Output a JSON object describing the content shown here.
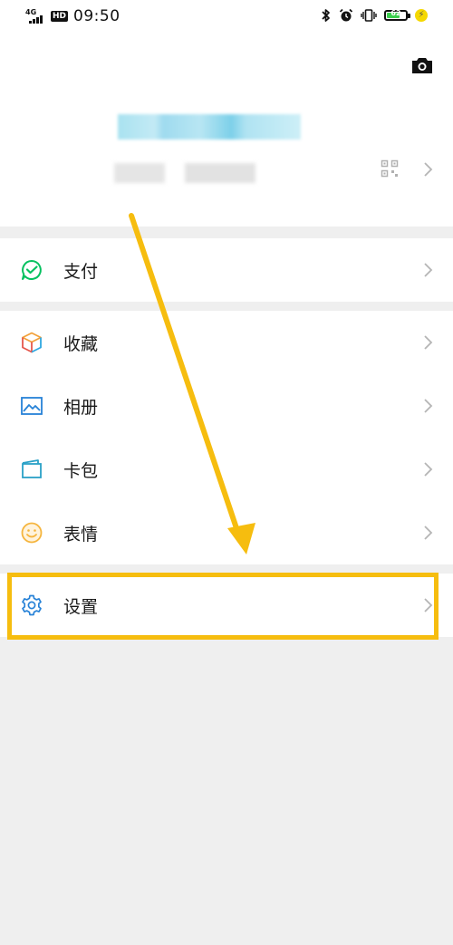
{
  "status_bar": {
    "network": "4G",
    "hd_badge": "HD",
    "time": "09:50",
    "battery_level": "62",
    "icons": [
      "bluetooth-icon",
      "alarm-icon",
      "vibrate-icon",
      "battery-icon",
      "charging-icon"
    ]
  },
  "profile": {
    "icons": [
      "camera-icon",
      "qr-code-icon",
      "chevron-right-icon"
    ]
  },
  "menu": {
    "pay": {
      "label": "支付",
      "icon": "wallet-check-icon",
      "color": "#07c160"
    },
    "favorites": {
      "label": "收藏",
      "icon": "cube-icon"
    },
    "album": {
      "label": "相册",
      "icon": "picture-icon",
      "color": "#2782d7"
    },
    "cards": {
      "label": "卡包",
      "icon": "card-wallet-icon",
      "color": "#2aa1c7"
    },
    "stickers": {
      "label": "表情",
      "icon": "smile-icon",
      "color": "#f5b53e"
    },
    "settings": {
      "label": "设置",
      "icon": "gear-icon",
      "color": "#2782d7"
    }
  },
  "annotation": {
    "highlight_color": "#f6bd0f"
  }
}
